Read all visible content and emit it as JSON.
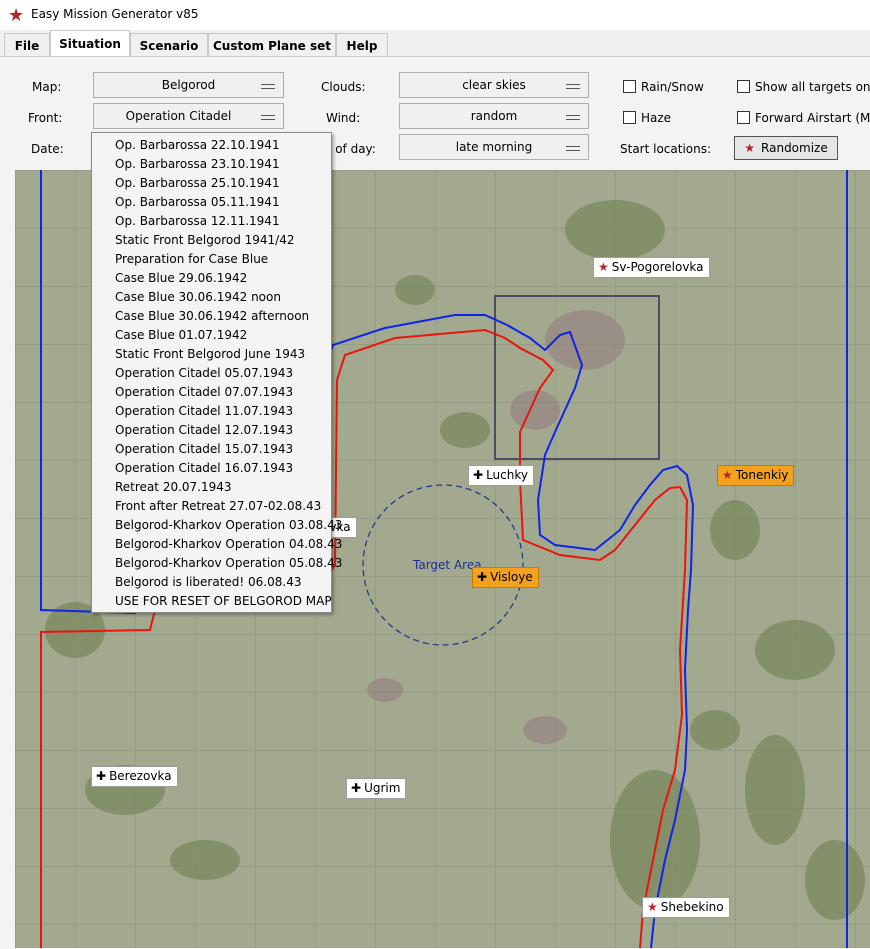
{
  "window": {
    "title": "Easy Mission Generator v85",
    "icon": "star-icon"
  },
  "tabs": [
    {
      "label": "File",
      "active": false
    },
    {
      "label": "Situation",
      "active": true
    },
    {
      "label": "Scenario",
      "active": false
    },
    {
      "label": "Custom Plane set",
      "active": false
    },
    {
      "label": "Help",
      "active": false
    }
  ],
  "controls": {
    "map_label": "Map:",
    "map_value": "Belgorod",
    "front_label": "Front:",
    "front_value": "Operation Citadel 12.07.1943",
    "date_label": "Date:",
    "clouds_label": "Clouds:",
    "clouds_value": "clear skies",
    "wind_label": "Wind:",
    "wind_value": "random",
    "time_label": "e of day:",
    "time_value": "late morning",
    "rain_label": "Rain/Snow",
    "haze_label": "Haze",
    "start_locations_label": "Start locations:",
    "show_targets_label": "Show all targets on m",
    "forward_airstart_label": "Forward Airstart (MP)",
    "randomize_label": "Randomize"
  },
  "front_options": [
    "Op. Barbarossa 22.10.1941",
    "Op. Barbarossa 23.10.1941",
    "Op. Barbarossa 25.10.1941",
    "Op. Barbarossa 05.11.1941",
    "Op. Barbarossa 12.11.1941",
    "Static Front Belgorod 1941/42",
    "Preparation for Case Blue",
    "Case Blue 29.06.1942",
    "Case Blue 30.06.1942 noon",
    "Case Blue 30.06.1942 afternoon",
    "Case Blue 01.07.1942",
    "Static Front Belgorod June 1943",
    "Operation Citadel 05.07.1943",
    "Operation Citadel 07.07.1943",
    "Operation Citadel 11.07.1943",
    "Operation Citadel 12.07.1943",
    "Operation Citadel 15.07.1943",
    "Operation Citadel 16.07.1943",
    "Retreat 20.07.1943",
    "Front after Retreat 27.07-02.08.43",
    "Belgorod-Kharkov Operation 03.08.43",
    "Belgorod-Kharkov Operation 04.08.43",
    "Belgorod-Kharkov Operation 05.08.43",
    "Belgorod is liberated! 06.08.43",
    "USE FOR RESET OF BELGOROD MAP"
  ],
  "map": {
    "target_area_label": "Target Area",
    "locations": {
      "sv_pogorelovka": "Sv-Pogorelovka",
      "tonenkiy": "Tonenkiy",
      "luchky": "Luchky",
      "visloye": "Visloye",
      "partial": "evka",
      "berezovka": "Berezovka",
      "ugrim": "Ugrim",
      "shebekino": "Shebekino"
    },
    "colors": {
      "axis_front": "#e8150e",
      "soviet_front": "#1024e6",
      "selected": "#f4a11d"
    }
  }
}
